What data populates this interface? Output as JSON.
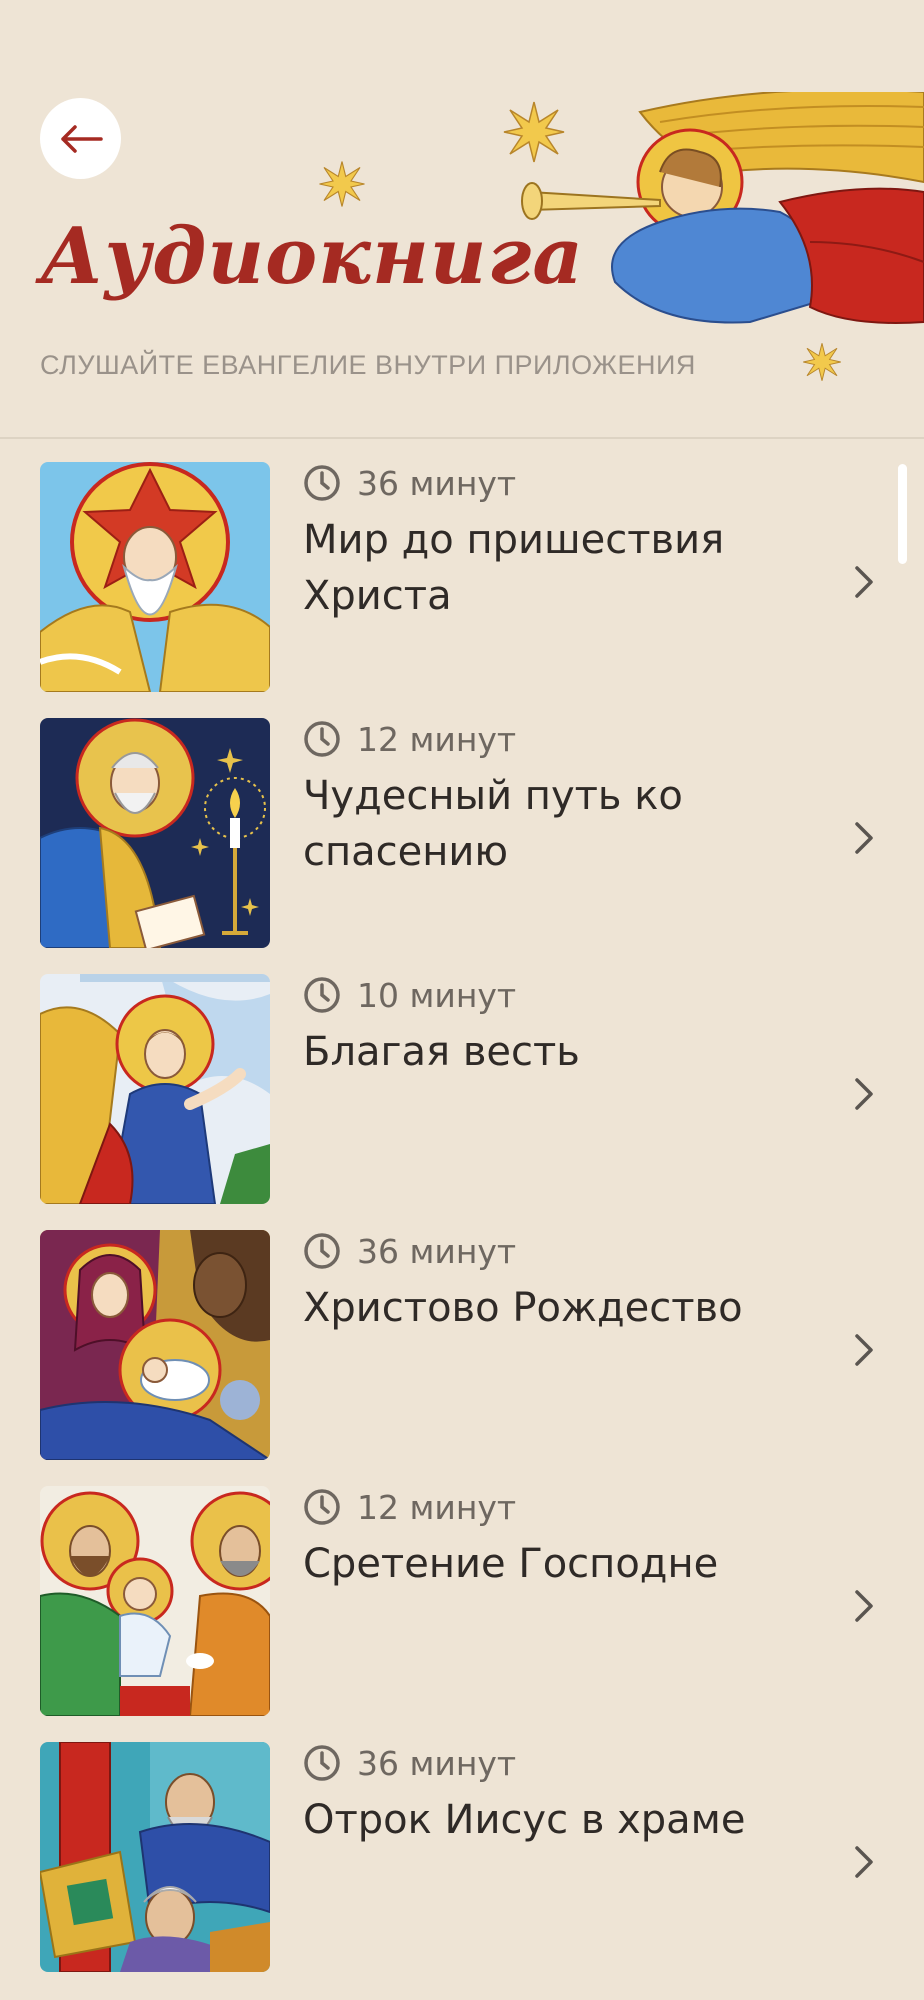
{
  "header": {
    "title": "Аудиокнига",
    "subtitle": "СЛУШАЙТЕ ЕВАНГЕЛИЕ ВНУТРИ ПРИЛОЖЕНИЯ",
    "back_icon": "arrow-left-icon"
  },
  "colors": {
    "background": "#EEE4D5",
    "title": "#A52A22",
    "subtitle": "#9A928A",
    "text": "#2F2A27",
    "duration": "#6E6760"
  },
  "items": [
    {
      "duration": "36 минут",
      "title": "Мир до пришествия Христа",
      "icon": "prophet-icon-illustration"
    },
    {
      "duration": "12 минут",
      "title": "Чудесный путь ко спасению",
      "icon": "evangelist-writing-illustration"
    },
    {
      "duration": "10 минут",
      "title": "Благая весть",
      "icon": "annunciation-angel-illustration"
    },
    {
      "duration": "36 минут",
      "title": "Христово Рождество",
      "icon": "nativity-illustration"
    },
    {
      "duration": "12 минут",
      "title": "Сретение Господне",
      "icon": "presentation-illustration"
    },
    {
      "duration": "36 минут",
      "title": "Отрок Иисус в храме",
      "icon": "young-jesus-temple-illustration"
    }
  ]
}
